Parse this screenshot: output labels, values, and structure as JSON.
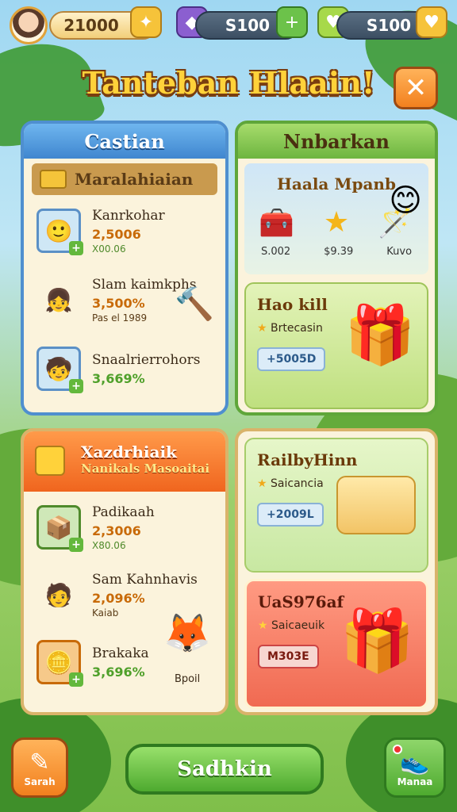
{
  "topbar": {
    "coins": "21000",
    "gems": "S100",
    "energy": "S100"
  },
  "title": "Tanteban Hlaain!",
  "left_panel": {
    "header": "Castian",
    "section": "Maralahiaian",
    "rows": [
      {
        "name": "Kanrkohar",
        "price": "2,5006",
        "sub": "X00.06"
      },
      {
        "name": "Slam kaimkphs",
        "price": "3,500%",
        "sub": "Pas el 1989"
      },
      {
        "name": "Snaalrierrohors",
        "price": "3,669%",
        "sub": ""
      }
    ]
  },
  "right_panel": {
    "header": "Nnbarkan",
    "reward_title": "Haala Mpanb",
    "reward_labels": [
      "S.002",
      "$9.39",
      "Kuvo"
    ],
    "offer": {
      "name": "Hao kill",
      "sub": "Brtecasin",
      "price": "+5005D"
    }
  },
  "left_panel2": {
    "title": "Xazdrhiaik",
    "subtitle": "Nanikals Masoaitai",
    "rows": [
      {
        "name": "Padikaah",
        "price": "2,3006",
        "sub": "X80.06"
      },
      {
        "name": "Sam Kahnhavis",
        "price": "2,096%",
        "sub": "Kaiab"
      },
      {
        "name": "Brakaka",
        "price": "3,696%",
        "sub": ""
      }
    ],
    "mascot_label": "Bpoil"
  },
  "right_panel2": {
    "offer1": {
      "name": "RailbyHinn",
      "sub": "Saicancia",
      "price": "+2009L"
    },
    "offer2": {
      "name": "UaS976af",
      "sub": "Saicaeuik",
      "price": "M303E"
    }
  },
  "bottom": {
    "left_label": "Sarah",
    "center_label": "Sadhkin",
    "right_label": "Manaa"
  }
}
